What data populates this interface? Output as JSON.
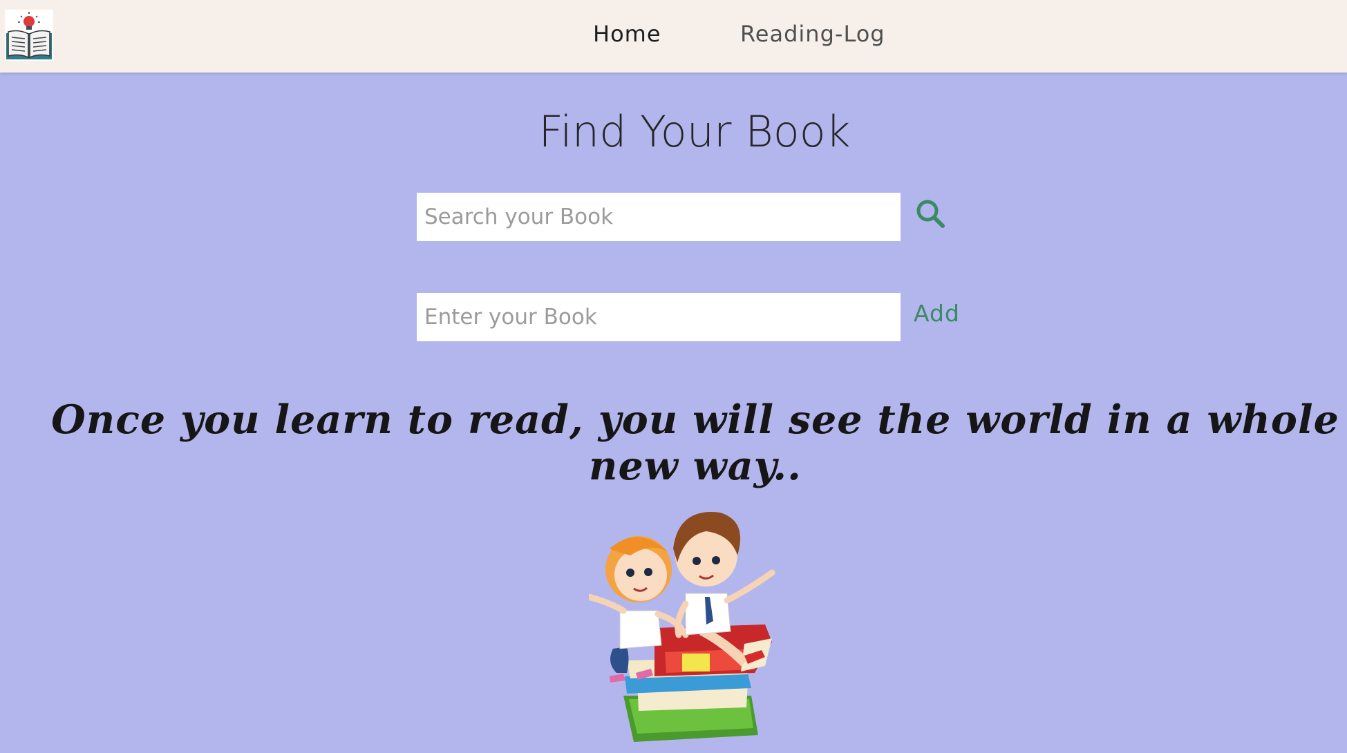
{
  "nav": {
    "logo_icon": "open-book-lightbulb-icon",
    "links": [
      {
        "label": "Home",
        "active": true
      },
      {
        "label": "Reading-Log",
        "active": false
      }
    ]
  },
  "main": {
    "title": "Find Your Book",
    "search": {
      "placeholder": "Search your Book",
      "value": "",
      "button_icon": "search-icon"
    },
    "add": {
      "placeholder": "Enter your Book",
      "value": "",
      "button_label": "Add"
    },
    "quote": "Once you learn to read, you will see the world in a whole new way..",
    "illustration_icon": "kids-reading-on-books-illustration"
  },
  "colors": {
    "background": "#b3b6ed",
    "navbar": "#f7f0ea",
    "accent": "#3a8a64"
  }
}
